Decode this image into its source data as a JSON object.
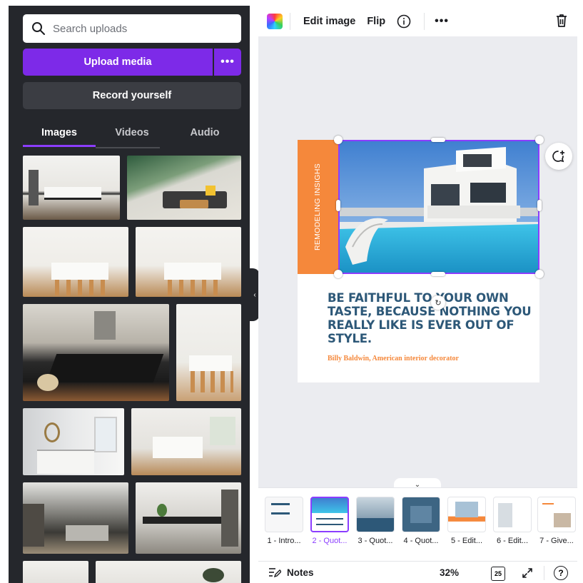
{
  "search": {
    "placeholder": "Search uploads"
  },
  "upload": {
    "label": "Upload media",
    "more_label": "•••"
  },
  "record": {
    "label": "Record yourself"
  },
  "tabs": [
    {
      "label": "Images",
      "active": true
    },
    {
      "label": "Videos",
      "active": false
    },
    {
      "label": "Audio",
      "active": false
    }
  ],
  "toolbar": {
    "edit_image": "Edit image",
    "flip": "Flip",
    "more": "•••",
    "icons": [
      "color-picker-icon",
      "info-icon",
      "trash-icon"
    ]
  },
  "design": {
    "vertical_text": "REMODELING INSIGHS",
    "quote": "BE FAITHFUL TO YOUR OWN TASTE, BECAUSE NOTHING YOU REALLY LIKE IS EVER OUT OF STYLE.",
    "author": "Billy Baldwin, American interior decorator"
  },
  "pages": [
    {
      "label": "1 - Intro...",
      "active": false
    },
    {
      "label": "2 - Quot...",
      "active": true
    },
    {
      "label": "3 - Quot...",
      "active": false
    },
    {
      "label": "4 - Quot...",
      "active": false
    },
    {
      "label": "5 - Edit...",
      "active": false
    },
    {
      "label": "6 - Edit...",
      "active": false
    },
    {
      "label": "7 - Give...",
      "active": false
    }
  ],
  "footer": {
    "notes": "Notes",
    "zoom": "32%",
    "page_count": "25",
    "help": "?"
  },
  "colors": {
    "accent": "#8b3dff",
    "upload_button": "#7d2ae8",
    "panel_bg": "#25272c",
    "orange": "#f5883b",
    "quote_text": "#2d5878"
  }
}
